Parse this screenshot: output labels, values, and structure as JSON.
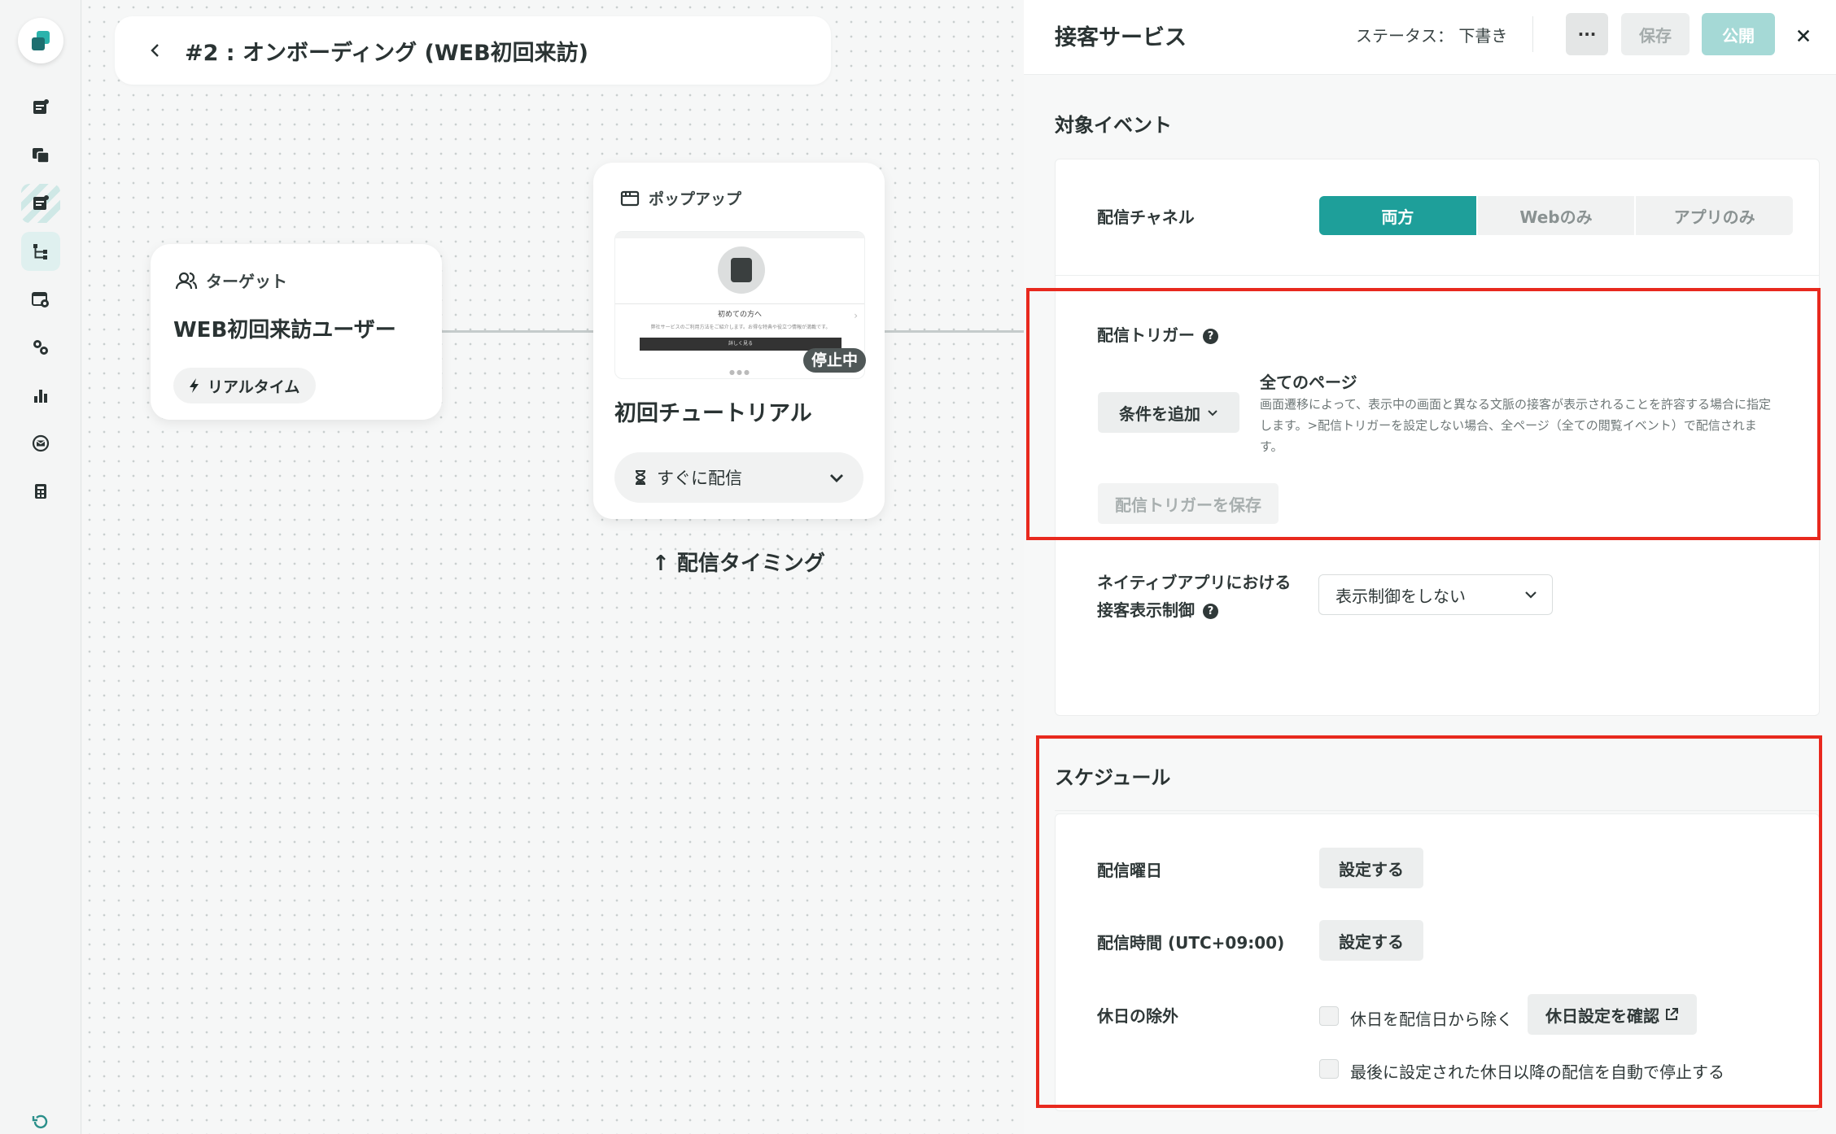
{
  "canvas": {
    "title": "#2 : オンボーディング (WEB初回来訪)",
    "target_node": {
      "header": "ターゲット",
      "name": "WEB初回来訪ユーザー",
      "chip": "リアルタイム"
    },
    "popup_node": {
      "header": "ポップアップ",
      "preview_title": "初めての方へ",
      "preview_desc": "弊社サービスのご利用方法をご紹介します。お得な特典や役立つ情報が満載です。",
      "preview_button": "詳しく見る",
      "status_badge": "停止中",
      "name": "初回チュートリアル",
      "timing": "すぐに配信"
    },
    "timing_note": "↑ 配信タイミング"
  },
  "panel": {
    "title": "接客サービス",
    "status": "ステータス： 下書き",
    "more_label": "···",
    "save_label": "保存",
    "publish_label": "公開",
    "target_event": {
      "section_title": "対象イベント",
      "channel_label": "配信チャネル",
      "channel_options": [
        "両方",
        "Webのみ",
        "アプリのみ"
      ],
      "channel_selected": "両方",
      "trigger_label": "配信トリガー",
      "add_condition": "条件を追加",
      "trigger_title": "全てのページ",
      "trigger_desc": "画面遷移によって、表示中の画面と異なる文脈の接客が表示されることを許容する場合に指定します。>配信トリガーを設定しない場合、全ページ（全ての閲覧イベント）で配信されます。",
      "save_trigger": "配信トリガーを保存",
      "native_label_1": "ネイティブアプリにおける",
      "native_label_2": "接客表示制御",
      "native_select": "表示制御をしない"
    },
    "schedule": {
      "section_title": "スケジュール",
      "weekday_label": "配信曜日",
      "weekday_button": "設定する",
      "time_label": "配信時間 (UTC+09:00)",
      "time_button": "設定する",
      "holiday_label": "休日の除外",
      "holiday_check_1": "休日を配信日から除く",
      "holiday_confirm": "休日設定を確認",
      "holiday_check_2": "最後に設定された休日以降の配信を自動で停止する"
    }
  },
  "colors": {
    "accent": "#1e9f9a",
    "accent_light": "#a5d9d6",
    "highlight_red": "#e8291e"
  },
  "icons": [
    "logo-icon",
    "content-icon",
    "templates-icon",
    "document-icon",
    "flow-icon",
    "calendar-settings-icon",
    "gear-icon",
    "bar-chart-icon",
    "mail-icon",
    "calculator-icon",
    "history-icon",
    "back-icon",
    "users-icon",
    "bolt-icon",
    "window-icon",
    "hourglass-icon",
    "chevron-down-icon",
    "close-icon",
    "help-icon",
    "external-link-icon"
  ]
}
